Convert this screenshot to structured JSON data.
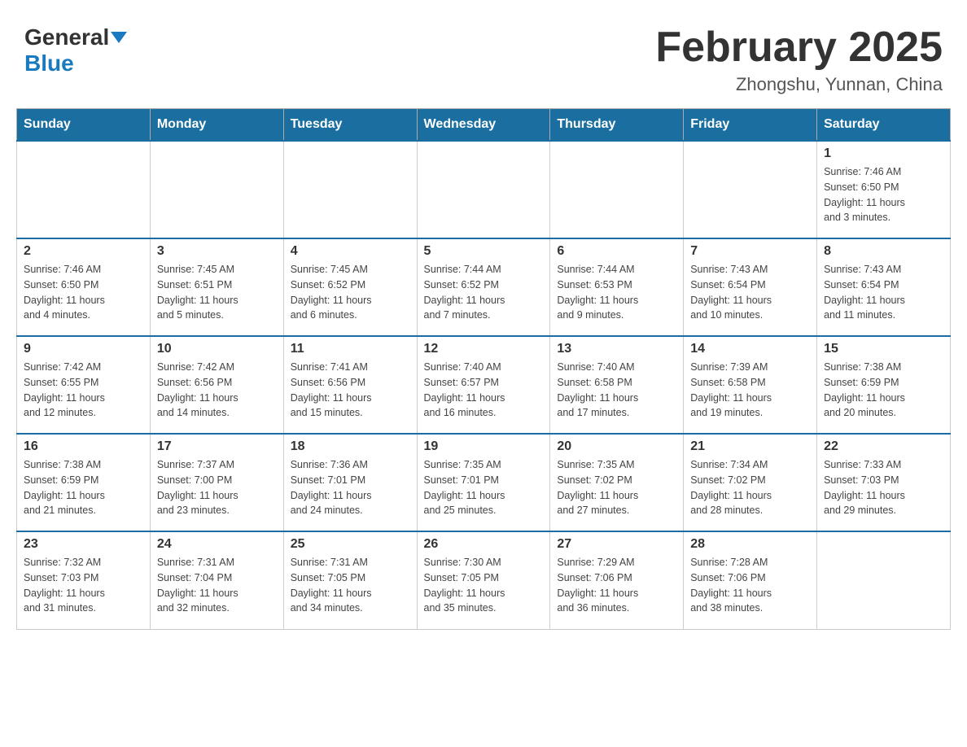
{
  "header": {
    "logo_general": "General",
    "logo_blue": "Blue",
    "month_title": "February 2025",
    "location": "Zhongshu, Yunnan, China"
  },
  "days_of_week": [
    "Sunday",
    "Monday",
    "Tuesday",
    "Wednesday",
    "Thursday",
    "Friday",
    "Saturday"
  ],
  "weeks": [
    {
      "days": [
        {
          "number": "",
          "info": ""
        },
        {
          "number": "",
          "info": ""
        },
        {
          "number": "",
          "info": ""
        },
        {
          "number": "",
          "info": ""
        },
        {
          "number": "",
          "info": ""
        },
        {
          "number": "",
          "info": ""
        },
        {
          "number": "1",
          "info": "Sunrise: 7:46 AM\nSunset: 6:50 PM\nDaylight: 11 hours\nand 3 minutes."
        }
      ]
    },
    {
      "days": [
        {
          "number": "2",
          "info": "Sunrise: 7:46 AM\nSunset: 6:50 PM\nDaylight: 11 hours\nand 4 minutes."
        },
        {
          "number": "3",
          "info": "Sunrise: 7:45 AM\nSunset: 6:51 PM\nDaylight: 11 hours\nand 5 minutes."
        },
        {
          "number": "4",
          "info": "Sunrise: 7:45 AM\nSunset: 6:52 PM\nDaylight: 11 hours\nand 6 minutes."
        },
        {
          "number": "5",
          "info": "Sunrise: 7:44 AM\nSunset: 6:52 PM\nDaylight: 11 hours\nand 7 minutes."
        },
        {
          "number": "6",
          "info": "Sunrise: 7:44 AM\nSunset: 6:53 PM\nDaylight: 11 hours\nand 9 minutes."
        },
        {
          "number": "7",
          "info": "Sunrise: 7:43 AM\nSunset: 6:54 PM\nDaylight: 11 hours\nand 10 minutes."
        },
        {
          "number": "8",
          "info": "Sunrise: 7:43 AM\nSunset: 6:54 PM\nDaylight: 11 hours\nand 11 minutes."
        }
      ]
    },
    {
      "days": [
        {
          "number": "9",
          "info": "Sunrise: 7:42 AM\nSunset: 6:55 PM\nDaylight: 11 hours\nand 12 minutes."
        },
        {
          "number": "10",
          "info": "Sunrise: 7:42 AM\nSunset: 6:56 PM\nDaylight: 11 hours\nand 14 minutes."
        },
        {
          "number": "11",
          "info": "Sunrise: 7:41 AM\nSunset: 6:56 PM\nDaylight: 11 hours\nand 15 minutes."
        },
        {
          "number": "12",
          "info": "Sunrise: 7:40 AM\nSunset: 6:57 PM\nDaylight: 11 hours\nand 16 minutes."
        },
        {
          "number": "13",
          "info": "Sunrise: 7:40 AM\nSunset: 6:58 PM\nDaylight: 11 hours\nand 17 minutes."
        },
        {
          "number": "14",
          "info": "Sunrise: 7:39 AM\nSunset: 6:58 PM\nDaylight: 11 hours\nand 19 minutes."
        },
        {
          "number": "15",
          "info": "Sunrise: 7:38 AM\nSunset: 6:59 PM\nDaylight: 11 hours\nand 20 minutes."
        }
      ]
    },
    {
      "days": [
        {
          "number": "16",
          "info": "Sunrise: 7:38 AM\nSunset: 6:59 PM\nDaylight: 11 hours\nand 21 minutes."
        },
        {
          "number": "17",
          "info": "Sunrise: 7:37 AM\nSunset: 7:00 PM\nDaylight: 11 hours\nand 23 minutes."
        },
        {
          "number": "18",
          "info": "Sunrise: 7:36 AM\nSunset: 7:01 PM\nDaylight: 11 hours\nand 24 minutes."
        },
        {
          "number": "19",
          "info": "Sunrise: 7:35 AM\nSunset: 7:01 PM\nDaylight: 11 hours\nand 25 minutes."
        },
        {
          "number": "20",
          "info": "Sunrise: 7:35 AM\nSunset: 7:02 PM\nDaylight: 11 hours\nand 27 minutes."
        },
        {
          "number": "21",
          "info": "Sunrise: 7:34 AM\nSunset: 7:02 PM\nDaylight: 11 hours\nand 28 minutes."
        },
        {
          "number": "22",
          "info": "Sunrise: 7:33 AM\nSunset: 7:03 PM\nDaylight: 11 hours\nand 29 minutes."
        }
      ]
    },
    {
      "days": [
        {
          "number": "23",
          "info": "Sunrise: 7:32 AM\nSunset: 7:03 PM\nDaylight: 11 hours\nand 31 minutes."
        },
        {
          "number": "24",
          "info": "Sunrise: 7:31 AM\nSunset: 7:04 PM\nDaylight: 11 hours\nand 32 minutes."
        },
        {
          "number": "25",
          "info": "Sunrise: 7:31 AM\nSunset: 7:05 PM\nDaylight: 11 hours\nand 34 minutes."
        },
        {
          "number": "26",
          "info": "Sunrise: 7:30 AM\nSunset: 7:05 PM\nDaylight: 11 hours\nand 35 minutes."
        },
        {
          "number": "27",
          "info": "Sunrise: 7:29 AM\nSunset: 7:06 PM\nDaylight: 11 hours\nand 36 minutes."
        },
        {
          "number": "28",
          "info": "Sunrise: 7:28 AM\nSunset: 7:06 PM\nDaylight: 11 hours\nand 38 minutes."
        },
        {
          "number": "",
          "info": ""
        }
      ]
    }
  ]
}
